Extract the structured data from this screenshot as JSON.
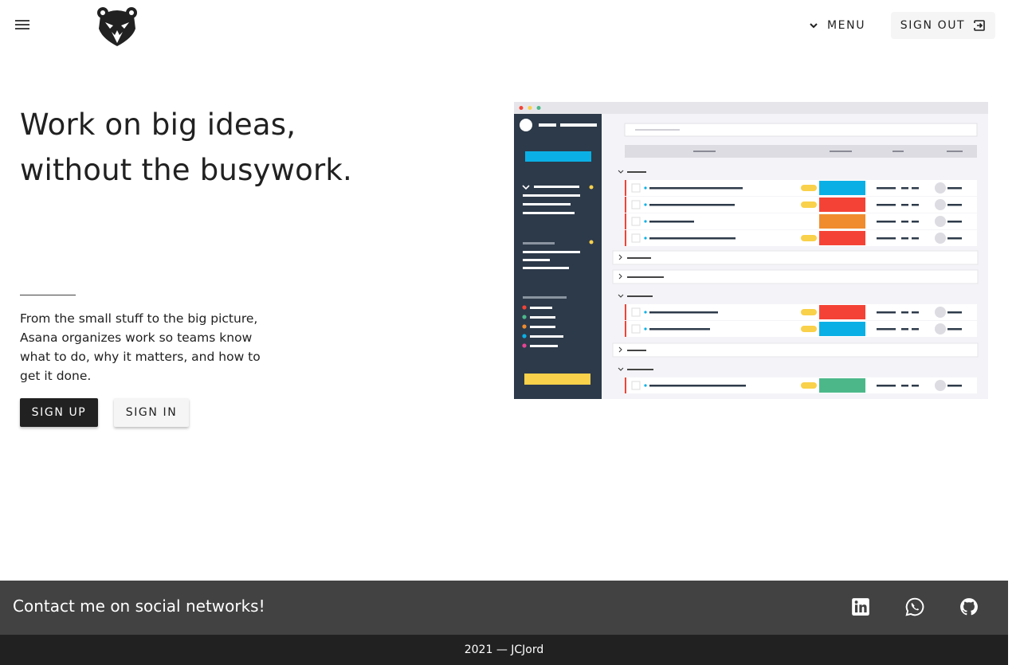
{
  "header": {
    "menu_label": "MENU",
    "signout_label": "SIGN OUT"
  },
  "hero": {
    "title_line1": "Work on big ideas,",
    "title_line2": "without the busywork.",
    "description": "From the small stuff to the big picture, Asana organizes work so teams know what to do, why it matters, and how to get it done.",
    "signup_label": "SIGN UP",
    "signin_label": "SIGN IN"
  },
  "footer": {
    "contact_text": "Contact me on social networks!",
    "social": [
      "linkedin-icon",
      "whatsapp-icon",
      "github-icon"
    ],
    "copyright": "2021 — JCJord"
  },
  "colors": {
    "dark": "#212121",
    "footer_bg": "#424242",
    "sidebar": "#2d3a4a",
    "accent_blue": "#0ab0e5",
    "accent_red": "#f44336",
    "accent_orange": "#f08c2e",
    "accent_green": "#4cb88a",
    "accent_yellow": "#f9d14a"
  }
}
